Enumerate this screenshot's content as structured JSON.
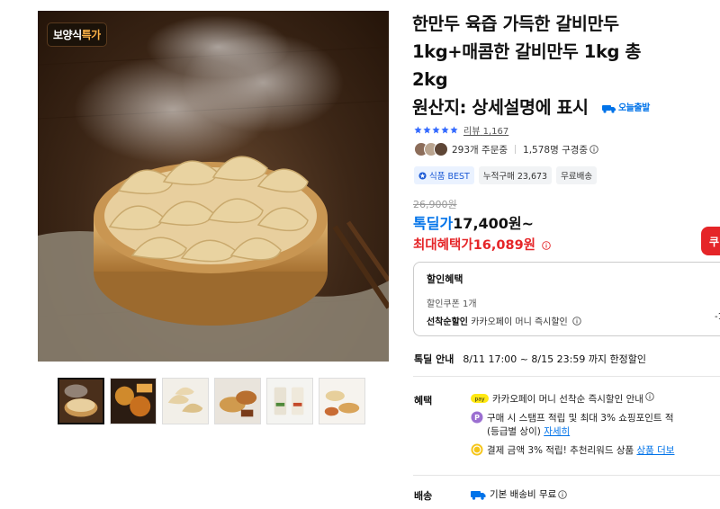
{
  "badge": {
    "prefix": "보양식",
    "highlight": "특가"
  },
  "product": {
    "title_lines": [
      "한만두 육즙 가득한 갈비만두",
      "1kg+매콤한 갈비만두 1kg 총",
      "2kg"
    ],
    "origin": "원산지: 상세설명에 표시",
    "delivery_badge": "오늘출발"
  },
  "rating": {
    "stars": 5,
    "review_label": "리뷰",
    "review_count": "1,167"
  },
  "buyers": {
    "orders": "293개 주문중",
    "subscribers": "1,578명 구경중"
  },
  "tags": [
    "식품 BEST",
    "누적구매 23,673",
    "무료배송"
  ],
  "price": {
    "original": "26,900원",
    "deal_label": "톡딜가",
    "deal_value": "17,400원~",
    "max_label": "최대혜택가",
    "max_value": "16,089원",
    "coupon_button": "쿠"
  },
  "discount": {
    "title": "할인혜택",
    "coupon_row": "할인쿠폰 1개",
    "first_come_label": "선착순할인",
    "first_come_text": "카카오페이 머니 즉시할인",
    "right_value": "-1"
  },
  "deal_info": {
    "label": "톡딜 안내",
    "text": "8/11 17:00 ~ 8/15 23:59 까지 한정할인"
  },
  "benefits": {
    "label": "혜택",
    "items": [
      {
        "text": "카카오페이 머니 선착순 즉시할인 안내"
      },
      {
        "text": "구매 시 스탬프 적립 및 최대 3% 쇼핑포인트 적",
        "sub": "(등급별 상이)",
        "link": "자세히"
      },
      {
        "text": "결제 금액 3% 적립! 추천리워드 상품",
        "link": "상품 더보"
      }
    ]
  },
  "shipping": {
    "label": "배송",
    "text": "기본 배송비 무료"
  },
  "colors": {
    "accent_blue": "#0073e9",
    "price_red": "#e52528",
    "star": "#346aff"
  }
}
